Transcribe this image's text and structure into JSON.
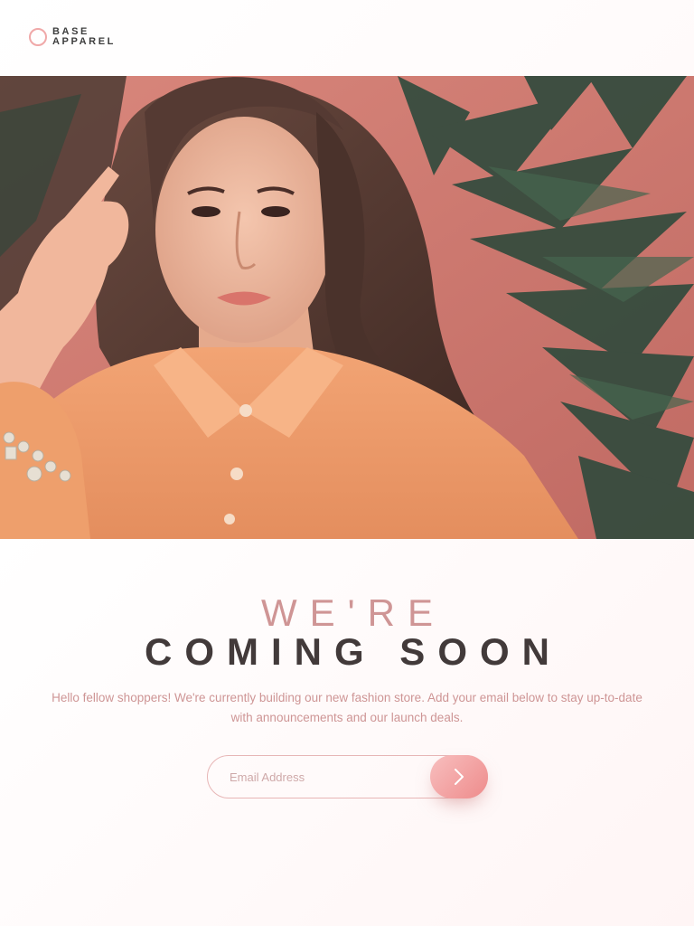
{
  "brand": {
    "line1": "BASE",
    "line2": "APPAREL",
    "accent_color": "#f0a8a8"
  },
  "hero": {
    "image": "woman-in-peach-shirt-with-plants"
  },
  "headline": {
    "light": "WE'RE",
    "dark": "COMING SOON"
  },
  "description": "Hello fellow shoppers! We're currently building our new fashion store. Add your email below to stay up-to-date with announcements and our launch deals.",
  "signup": {
    "placeholder": "Email Address",
    "submit_icon": "arrow-right-icon"
  },
  "colors": {
    "primary": "#ce9595",
    "dark": "#423a3a",
    "button_gradient_start": "#f8bfbf",
    "button_gradient_end": "#ee8b8b"
  }
}
